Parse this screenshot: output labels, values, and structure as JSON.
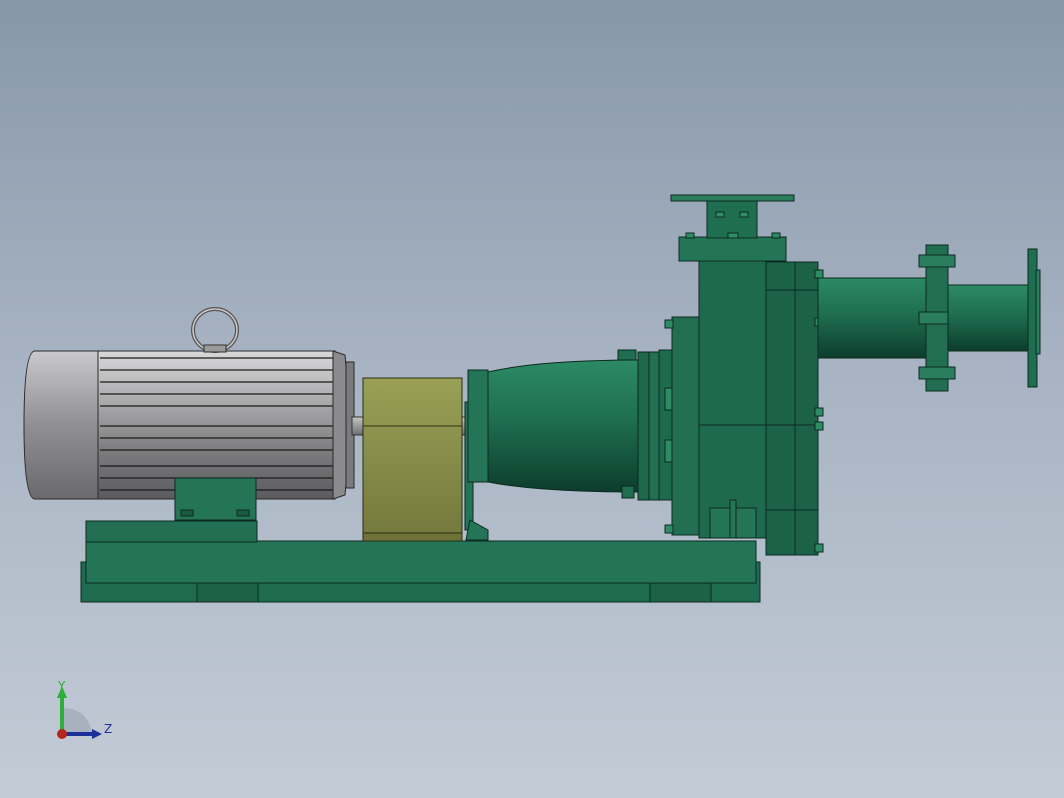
{
  "viewport": {
    "background_top": "#8797aa",
    "background_bottom": "#c3cbd6"
  },
  "model": {
    "parts": [
      "motor",
      "lifting-eye",
      "coupling-guard",
      "bearing-housing",
      "pump-casing",
      "discharge-pipe",
      "suction-flange",
      "base-frame"
    ],
    "colors": {
      "pump_green": "#1f6e52",
      "pump_green_dark": "#0f3f2f",
      "motor_grey": "#8d8d8f",
      "coupling_olive": "#808445"
    }
  },
  "triad": {
    "y_label": "Y",
    "z_label": "Z",
    "y_color": "#2fae3a",
    "z_color": "#1f2f9a",
    "x_color": "#b3261e"
  }
}
